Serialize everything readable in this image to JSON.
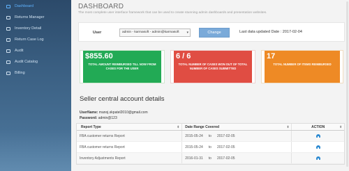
{
  "sidebar": {
    "items": [
      {
        "label": "Dashboard",
        "active": true
      },
      {
        "label": "Returns Manager",
        "active": false
      },
      {
        "label": "Inventory Detail",
        "active": false
      },
      {
        "label": "Return Case Log",
        "active": false
      },
      {
        "label": "Audit",
        "active": false
      },
      {
        "label": "Audit Catalog",
        "active": false
      },
      {
        "label": "Billing",
        "active": false
      }
    ]
  },
  "header": {
    "title": "DASHBOARD",
    "subtitle": "The most complete user interface framework that can be used to create stunning admin dashboards and presentation websites."
  },
  "filter": {
    "user_label": "User",
    "user_selected": "admin - karmasoft - admin@karmasoft",
    "change_label": "Change",
    "last_updated": "Last data updated Date : 2017-02-04"
  },
  "stats": [
    {
      "value": "$855.60",
      "label": "TOTAL AMOUNT REIMBURSED TILL NOW FROM CASES FOR THE USER",
      "color": "#22aa55"
    },
    {
      "value": "6 / 6",
      "label": "TOTAL NUMBER OF CASES WON OUT OF TOTAL NUMBER OF CASES SUBMITTED",
      "color": "#e04d43"
    },
    {
      "value": "17",
      "label": "TOTAL NUMBER OF ITEMS REIMBURSED",
      "color": "#ee8a25"
    }
  ],
  "account": {
    "heading": "Seller central account details",
    "username_label": "UserName:",
    "username_value": "manoj.skpatel2010@gmail.com",
    "password_label": "Password:",
    "password_value": "admin@123"
  },
  "table": {
    "headers": [
      "Report Type",
      "Date Range Covered",
      "ACTION"
    ],
    "rows": [
      {
        "type": "FBA customer returns Report",
        "from": "2015-05-24",
        "to_word": "to",
        "to": "2017-02-05"
      },
      {
        "type": "FBA customer returns Report",
        "from": "2015-05-24",
        "to_word": "to",
        "to": "2017-02-05"
      },
      {
        "type": "Inventory Adjustments Report",
        "from": "2016-01-31",
        "to_word": "to",
        "to": "2017-02-05"
      }
    ]
  }
}
